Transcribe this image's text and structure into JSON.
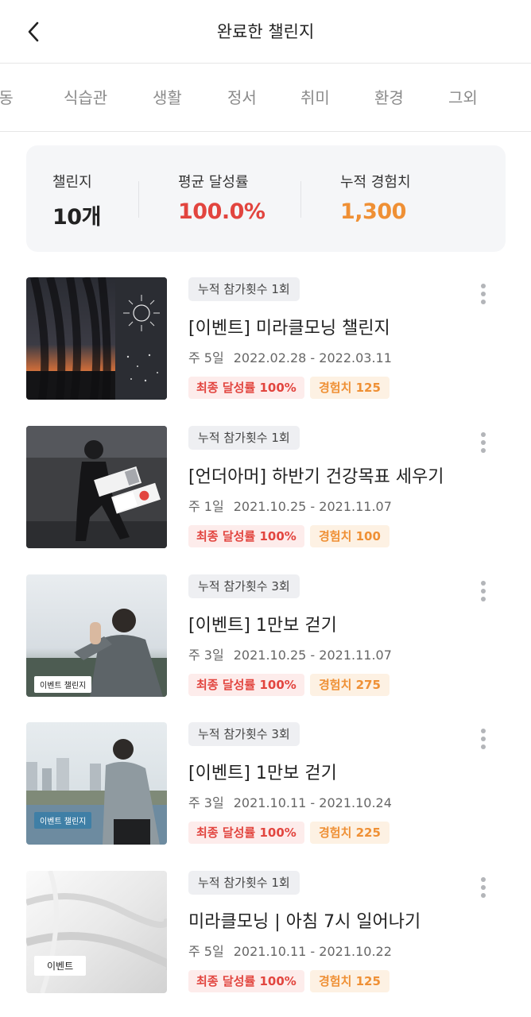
{
  "header": {
    "title": "완료한 챌린지"
  },
  "tabs": [
    "운동",
    "식습관",
    "생활",
    "정서",
    "취미",
    "환경",
    "그외"
  ],
  "summary": {
    "challenges_label": "챌린지",
    "challenges_value": "10개",
    "avg_rate_label": "평균 달성률",
    "avg_rate_value": "100.0%",
    "exp_label": "누적 경험치",
    "exp_value": "1,300"
  },
  "colors": {
    "rate_red": "#e2453f",
    "exp_orange": "#ef9035"
  },
  "challenges": [
    {
      "count": "누적 참가횟수 1회",
      "title": "[이벤트] 미라클모닝 챌린지",
      "week": "주 5일",
      "dates": "2022.02.28 - 2022.03.11",
      "rate": "최종 달성률 100%",
      "exp": "경험치 125",
      "thumb_tag": ""
    },
    {
      "count": "누적 참가횟수 1회",
      "title": "[언더아머] 하반기 건강목표 세우기",
      "week": "주 1일",
      "dates": "2021.10.25 - 2021.11.07",
      "rate": "최종 달성률 100%",
      "exp": "경험치 100",
      "thumb_tag": ""
    },
    {
      "count": "누적 참가횟수 3회",
      "title": "[이벤트] 1만보 걷기",
      "week": "주 3일",
      "dates": "2021.10.25 - 2021.11.07",
      "rate": "최종 달성률 100%",
      "exp": "경험치 275",
      "thumb_tag": "이벤트 챌린지"
    },
    {
      "count": "누적 참가횟수 3회",
      "title": "[이벤트] 1만보 걷기",
      "week": "주 3일",
      "dates": "2021.10.11 - 2021.10.24",
      "rate": "최종 달성률 100%",
      "exp": "경험치 225",
      "thumb_tag": "이벤트 챌린지"
    },
    {
      "count": "누적 참가횟수 1회",
      "title": "미라클모닝 | 아침 7시 일어나기",
      "week": "주 5일",
      "dates": "2021.10.11 - 2021.10.22",
      "rate": "최종 달성률 100%",
      "exp": "경험치 125",
      "thumb_tag": "이벤트"
    }
  ]
}
